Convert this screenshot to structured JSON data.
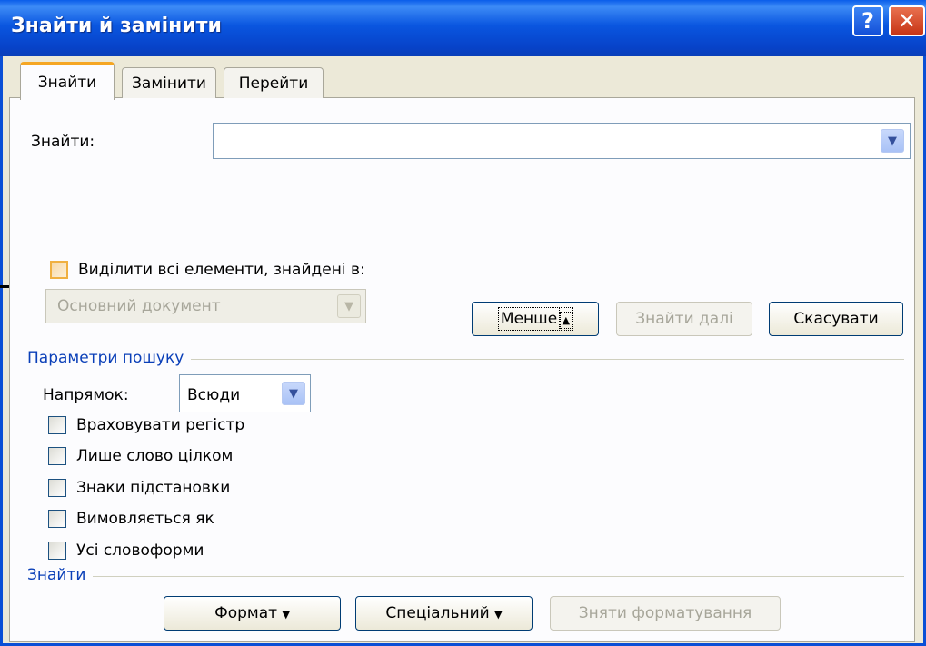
{
  "window": {
    "title": "Знайти й замінити",
    "help_glyph": "?",
    "close_glyph": "✕"
  },
  "tabs": [
    {
      "label": "Знайти",
      "active": true
    },
    {
      "label": "Замінити",
      "active": false
    },
    {
      "label": "Перейти",
      "active": false
    }
  ],
  "find": {
    "label": "Знайти:",
    "value": ""
  },
  "highlight": {
    "checkbox_label": "Виділити всі елементи, знайдені в:",
    "checked": false,
    "scope_value": "Основний документ"
  },
  "buttons": {
    "less": "Менше",
    "less_arrow": "▲",
    "find_next": "Знайти далі",
    "cancel": "Скасувати",
    "format": "Формат",
    "special": "Спеціальний",
    "no_formatting": "Зняти форматування",
    "menu_arrow": "▼"
  },
  "search_options": {
    "section_title": "Параметри пошуку",
    "direction_label": "Напрямок:",
    "direction_value": "Всюди",
    "checkboxes": [
      {
        "label": "Враховувати регістр",
        "checked": false
      },
      {
        "label": "Лише слово цілком",
        "checked": false
      },
      {
        "label": "Знаки підстановки",
        "checked": false
      },
      {
        "label": "Вимовляється як",
        "checked": false
      },
      {
        "label": "Усі словоформи",
        "checked": false
      }
    ]
  },
  "find_section_title": "Знайти",
  "icons": {
    "dropdown": "chevron-down-icon",
    "help": "help-icon",
    "close": "close-icon"
  },
  "colors": {
    "titlebar": "#0a56e0",
    "section_title": "#0a3fb8",
    "tab_highlight": "#f5a623",
    "close_button": "#c73516"
  }
}
